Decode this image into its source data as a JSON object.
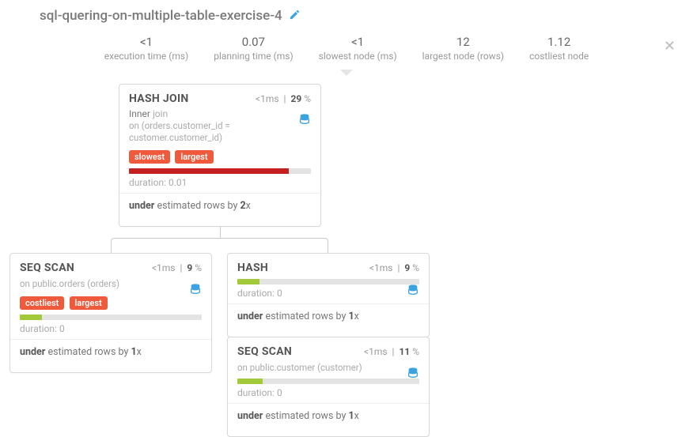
{
  "title": "sql-quering-on-multiple-table-exercise-4",
  "metrics": {
    "exec": {
      "val": "<1",
      "lbl": "execution time (ms)"
    },
    "plan": {
      "val": "0.07",
      "lbl": "planning time (ms)"
    },
    "slow": {
      "val": "<1",
      "lbl": "slowest node (ms)"
    },
    "large": {
      "val": "12",
      "lbl": "largest node (rows)"
    },
    "cost": {
      "val": "1.12",
      "lbl": "costliest node"
    }
  },
  "nodes": {
    "hashjoin": {
      "name": "HASH JOIN",
      "ms": "<1",
      "pct": "29",
      "sub1a": "Inner",
      "sub1b": "join",
      "sub2": "on (orders.customer_id = customer.customer_id)",
      "badges": [
        "slowest",
        "largest"
      ],
      "bar_pct": 88,
      "bar_color": "red",
      "duration": "duration: 0.01",
      "under_pre": "under",
      "under_mid": " estimated rows by ",
      "under_x": "2",
      "under_suf": "x"
    },
    "seqscan1": {
      "name": "SEQ SCAN",
      "ms": "<1",
      "pct": "9",
      "sub2": "on public.orders (orders)",
      "badges": [
        "costliest",
        "largest"
      ],
      "bar_pct": 12,
      "bar_color": "green",
      "duration": "duration: 0",
      "under_pre": "under",
      "under_mid": " estimated rows by ",
      "under_x": "1",
      "under_suf": "x"
    },
    "hash": {
      "name": "HASH",
      "ms": "<1",
      "pct": "9",
      "bar_pct": 12,
      "bar_color": "green",
      "duration": "duration: 0",
      "under_pre": "under",
      "under_mid": " estimated rows by ",
      "under_x": "1",
      "under_suf": "x"
    },
    "seqscan2": {
      "name": "SEQ SCAN",
      "ms": "<1",
      "pct": "11",
      "sub2": "on public.customer (customer)",
      "bar_pct": 14,
      "bar_color": "green",
      "duration": "duration: 0",
      "under_pre": "under",
      "under_mid": " estimated rows by ",
      "under_x": "1",
      "under_suf": "x"
    }
  }
}
